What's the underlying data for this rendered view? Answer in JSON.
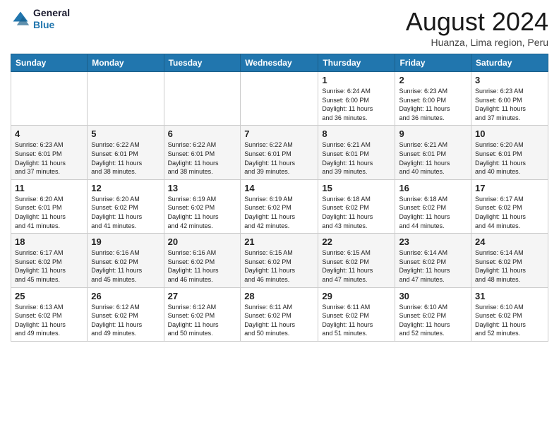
{
  "header": {
    "logo_line1": "General",
    "logo_line2": "Blue",
    "title": "August 2024",
    "subtitle": "Huanza, Lima region, Peru"
  },
  "days_of_week": [
    "Sunday",
    "Monday",
    "Tuesday",
    "Wednesday",
    "Thursday",
    "Friday",
    "Saturday"
  ],
  "weeks": [
    [
      {
        "day": "",
        "info": ""
      },
      {
        "day": "",
        "info": ""
      },
      {
        "day": "",
        "info": ""
      },
      {
        "day": "",
        "info": ""
      },
      {
        "day": "1",
        "info": "Sunrise: 6:24 AM\nSunset: 6:00 PM\nDaylight: 11 hours\nand 36 minutes."
      },
      {
        "day": "2",
        "info": "Sunrise: 6:23 AM\nSunset: 6:00 PM\nDaylight: 11 hours\nand 36 minutes."
      },
      {
        "day": "3",
        "info": "Sunrise: 6:23 AM\nSunset: 6:00 PM\nDaylight: 11 hours\nand 37 minutes."
      }
    ],
    [
      {
        "day": "4",
        "info": "Sunrise: 6:23 AM\nSunset: 6:01 PM\nDaylight: 11 hours\nand 37 minutes."
      },
      {
        "day": "5",
        "info": "Sunrise: 6:22 AM\nSunset: 6:01 PM\nDaylight: 11 hours\nand 38 minutes."
      },
      {
        "day": "6",
        "info": "Sunrise: 6:22 AM\nSunset: 6:01 PM\nDaylight: 11 hours\nand 38 minutes."
      },
      {
        "day": "7",
        "info": "Sunrise: 6:22 AM\nSunset: 6:01 PM\nDaylight: 11 hours\nand 39 minutes."
      },
      {
        "day": "8",
        "info": "Sunrise: 6:21 AM\nSunset: 6:01 PM\nDaylight: 11 hours\nand 39 minutes."
      },
      {
        "day": "9",
        "info": "Sunrise: 6:21 AM\nSunset: 6:01 PM\nDaylight: 11 hours\nand 40 minutes."
      },
      {
        "day": "10",
        "info": "Sunrise: 6:20 AM\nSunset: 6:01 PM\nDaylight: 11 hours\nand 40 minutes."
      }
    ],
    [
      {
        "day": "11",
        "info": "Sunrise: 6:20 AM\nSunset: 6:01 PM\nDaylight: 11 hours\nand 41 minutes."
      },
      {
        "day": "12",
        "info": "Sunrise: 6:20 AM\nSunset: 6:02 PM\nDaylight: 11 hours\nand 41 minutes."
      },
      {
        "day": "13",
        "info": "Sunrise: 6:19 AM\nSunset: 6:02 PM\nDaylight: 11 hours\nand 42 minutes."
      },
      {
        "day": "14",
        "info": "Sunrise: 6:19 AM\nSunset: 6:02 PM\nDaylight: 11 hours\nand 42 minutes."
      },
      {
        "day": "15",
        "info": "Sunrise: 6:18 AM\nSunset: 6:02 PM\nDaylight: 11 hours\nand 43 minutes."
      },
      {
        "day": "16",
        "info": "Sunrise: 6:18 AM\nSunset: 6:02 PM\nDaylight: 11 hours\nand 44 minutes."
      },
      {
        "day": "17",
        "info": "Sunrise: 6:17 AM\nSunset: 6:02 PM\nDaylight: 11 hours\nand 44 minutes."
      }
    ],
    [
      {
        "day": "18",
        "info": "Sunrise: 6:17 AM\nSunset: 6:02 PM\nDaylight: 11 hours\nand 45 minutes."
      },
      {
        "day": "19",
        "info": "Sunrise: 6:16 AM\nSunset: 6:02 PM\nDaylight: 11 hours\nand 45 minutes."
      },
      {
        "day": "20",
        "info": "Sunrise: 6:16 AM\nSunset: 6:02 PM\nDaylight: 11 hours\nand 46 minutes."
      },
      {
        "day": "21",
        "info": "Sunrise: 6:15 AM\nSunset: 6:02 PM\nDaylight: 11 hours\nand 46 minutes."
      },
      {
        "day": "22",
        "info": "Sunrise: 6:15 AM\nSunset: 6:02 PM\nDaylight: 11 hours\nand 47 minutes."
      },
      {
        "day": "23",
        "info": "Sunrise: 6:14 AM\nSunset: 6:02 PM\nDaylight: 11 hours\nand 47 minutes."
      },
      {
        "day": "24",
        "info": "Sunrise: 6:14 AM\nSunset: 6:02 PM\nDaylight: 11 hours\nand 48 minutes."
      }
    ],
    [
      {
        "day": "25",
        "info": "Sunrise: 6:13 AM\nSunset: 6:02 PM\nDaylight: 11 hours\nand 49 minutes."
      },
      {
        "day": "26",
        "info": "Sunrise: 6:12 AM\nSunset: 6:02 PM\nDaylight: 11 hours\nand 49 minutes."
      },
      {
        "day": "27",
        "info": "Sunrise: 6:12 AM\nSunset: 6:02 PM\nDaylight: 11 hours\nand 50 minutes."
      },
      {
        "day": "28",
        "info": "Sunrise: 6:11 AM\nSunset: 6:02 PM\nDaylight: 11 hours\nand 50 minutes."
      },
      {
        "day": "29",
        "info": "Sunrise: 6:11 AM\nSunset: 6:02 PM\nDaylight: 11 hours\nand 51 minutes."
      },
      {
        "day": "30",
        "info": "Sunrise: 6:10 AM\nSunset: 6:02 PM\nDaylight: 11 hours\nand 52 minutes."
      },
      {
        "day": "31",
        "info": "Sunrise: 6:10 AM\nSunset: 6:02 PM\nDaylight: 11 hours\nand 52 minutes."
      }
    ]
  ]
}
